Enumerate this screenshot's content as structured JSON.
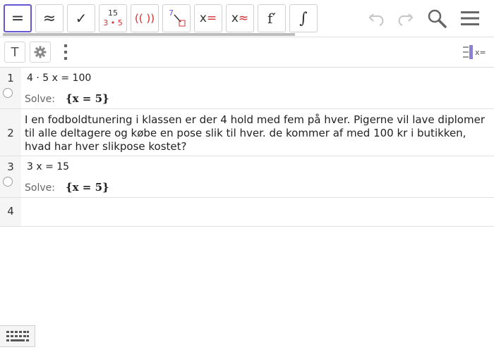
{
  "toolbar": {
    "buttons": [
      {
        "name": "evaluate-button",
        "glyph": "="
      },
      {
        "name": "numeric-button",
        "glyph": "≈"
      },
      {
        "name": "check-button",
        "glyph": "✓"
      },
      {
        "name": "factor-button",
        "top": "15",
        "bottom": "3 • 5"
      },
      {
        "name": "expand-button",
        "glyph": "(( ))"
      },
      {
        "name": "substitute-button",
        "glyph": "7"
      },
      {
        "name": "solve-button",
        "glyph": "x="
      },
      {
        "name": "nsolve-button",
        "glyph": "x≈"
      },
      {
        "name": "derivative-button",
        "glyph": "f′"
      },
      {
        "name": "integral-button",
        "glyph": "∫"
      }
    ]
  },
  "rows": [
    {
      "num": "1",
      "input": "4 · 5 x = 100",
      "solve_label": "Solve:",
      "result": "{x = 5}"
    },
    {
      "num": "2",
      "text": "I en fodboldtunering i klassen er der 4 hold med fem på hver. Pigerne vil lave diplomer til alle deltagere og købe en pose slik til hver. de kommer af med 100 kr i butikken, hvad har hver slikpose kostet?"
    },
    {
      "num": "3",
      "input": "3 x = 15",
      "solve_label": "Solve:",
      "result": "{x = 5}"
    },
    {
      "num": "4"
    }
  ],
  "secondary": {
    "text_tool": "T"
  },
  "colors": {
    "accent": "#6557d2",
    "red": "#d32f2f",
    "icon": "#666666"
  }
}
